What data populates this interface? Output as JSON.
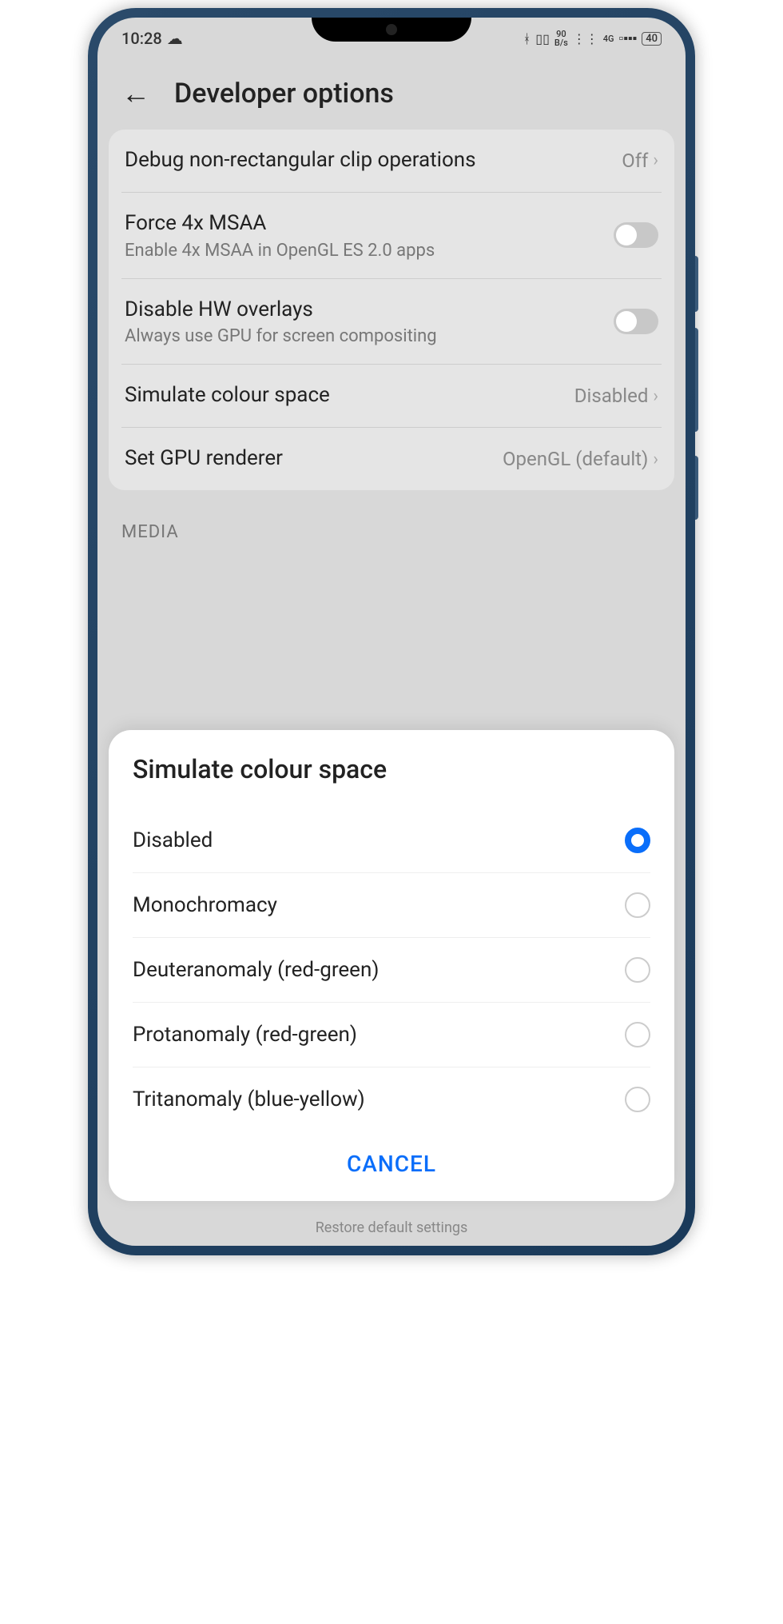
{
  "status": {
    "time": "10:28",
    "bluetooth": "✻",
    "vibrate": "▯",
    "speed_top": "90",
    "speed_bottom": "B/s",
    "wifi": "◈",
    "net": "4G",
    "signal": "▮▮▮▮",
    "battery": "40"
  },
  "header": {
    "title": "Developer options"
  },
  "settings": [
    {
      "title": "Debug non-rectangular clip operations",
      "sub": "",
      "value": "Off",
      "type": "chevron"
    },
    {
      "title": "Force 4x MSAA",
      "sub": "Enable 4x MSAA in OpenGL ES 2.0 apps",
      "value": "",
      "type": "toggle"
    },
    {
      "title": "Disable HW overlays",
      "sub": "Always use GPU for screen compositing",
      "value": "",
      "type": "toggle"
    },
    {
      "title": "Simulate colour space",
      "sub": "",
      "value": "Disabled",
      "type": "chevron"
    },
    {
      "title": "Set GPU renderer",
      "sub": "",
      "value": "OpenGL (default)",
      "type": "chevron"
    }
  ],
  "section_label": "MEDIA",
  "modal": {
    "title": "Simulate colour space",
    "options": [
      {
        "label": "Disabled",
        "selected": true
      },
      {
        "label": "Monochromacy",
        "selected": false
      },
      {
        "label": "Deuteranomaly (red-green)",
        "selected": false
      },
      {
        "label": "Protanomaly (red-green)",
        "selected": false
      },
      {
        "label": "Tritanomaly (blue-yellow)",
        "selected": false
      }
    ],
    "cancel": "CANCEL"
  },
  "restore_hint": "Restore default settings"
}
